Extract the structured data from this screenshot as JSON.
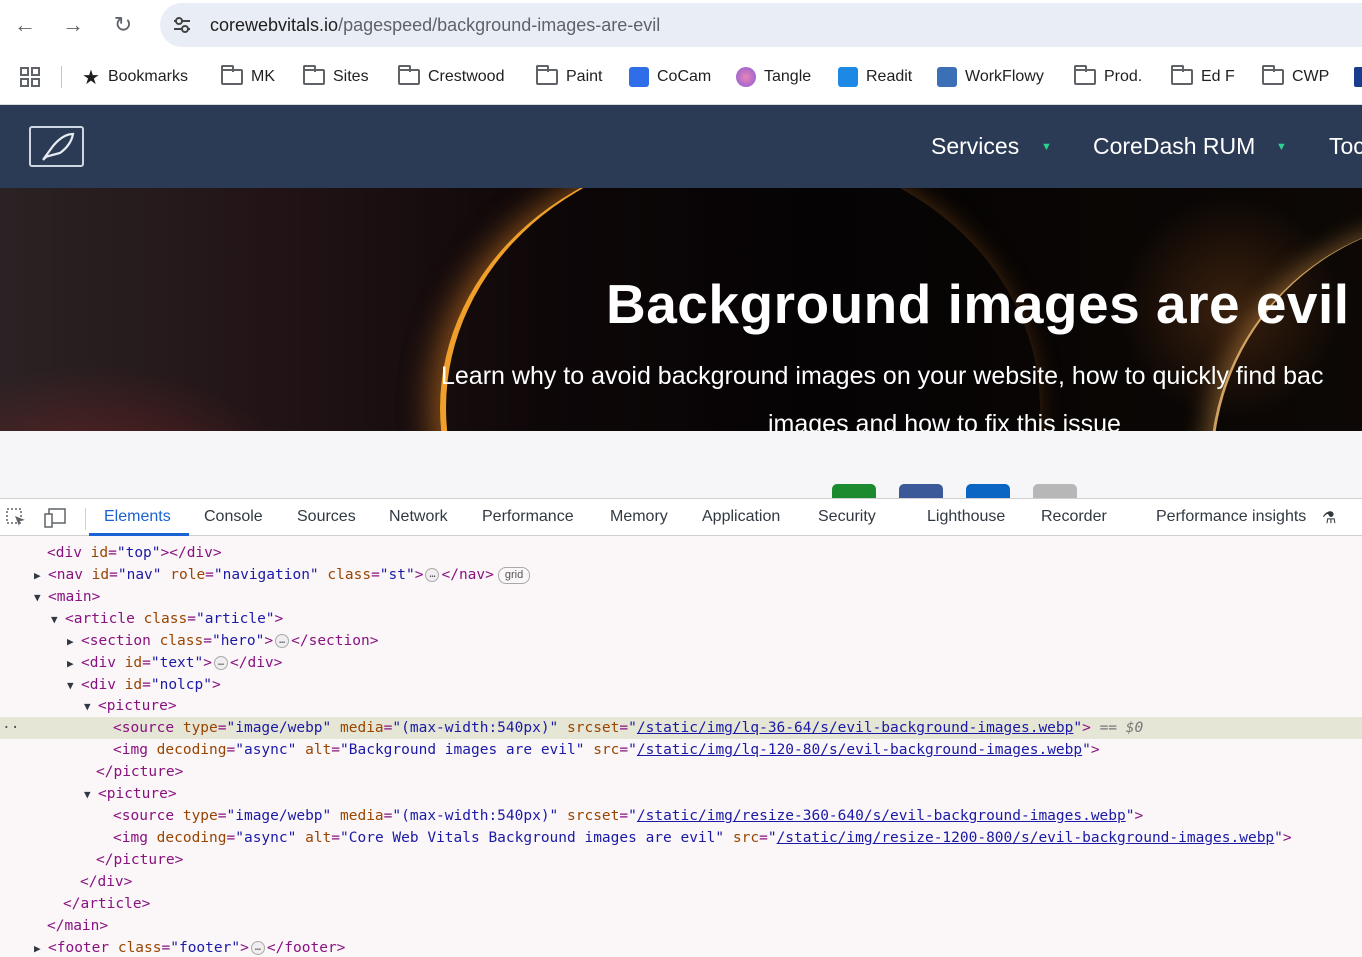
{
  "browser": {
    "url_host": "corewebvitals.io",
    "url_path": "/pagespeed/background-images-are-evil",
    "bookmarks": [
      {
        "label": "Bookmarks",
        "icon": "star-icon"
      },
      {
        "label": "MK",
        "icon": "folder-icon"
      },
      {
        "label": "Sites",
        "icon": "folder-icon"
      },
      {
        "label": "Crestwood",
        "icon": "folder-icon"
      },
      {
        "label": "Paint",
        "icon": "folder-icon"
      },
      {
        "label": "CoCam",
        "icon": "cocam-icon"
      },
      {
        "label": "Tangle",
        "icon": "tangle-icon"
      },
      {
        "label": "Readit",
        "icon": "readit-icon"
      },
      {
        "label": "WorkFlowy",
        "icon": "workflowy-icon"
      },
      {
        "label": "Prod.",
        "icon": "folder-icon"
      },
      {
        "label": "Ed F",
        "icon": "folder-icon"
      },
      {
        "label": "CWP",
        "icon": "folder-icon"
      }
    ]
  },
  "site": {
    "menu": [
      "Services",
      "CoreDash RUM",
      "Toc"
    ],
    "hero_title": "Background images are evil",
    "hero_sub_line1": "Learn why to avoid background images on your website, how to quickly find bac",
    "hero_sub_line2": "images and how to fix this issue"
  },
  "devtools": {
    "tabs": [
      "Elements",
      "Console",
      "Sources",
      "Network",
      "Performance",
      "Memory",
      "Application",
      "Security",
      "Lighthouse",
      "Recorder",
      "Performance insights"
    ],
    "active_tab": "Elements",
    "grid_badge": "grid",
    "selected_suffix": "== $0",
    "src": {
      "lq_36": "/static/img/lq-36-64/s/evil-background-images.webp",
      "lq_120": "/static/img/lq-120-80/s/evil-background-images.webp",
      "resize_360": "/static/img/resize-360-640/s/evil-background-images.webp",
      "resize_1200": "/static/img/resize-1200-800/s/evil-background-images.webp"
    },
    "alt1": "Background images are evil",
    "alt2": "Core Web Vitals Background images are evil",
    "media": "(max-width:540px)",
    "type": "image/webp",
    "decoding": "async"
  }
}
